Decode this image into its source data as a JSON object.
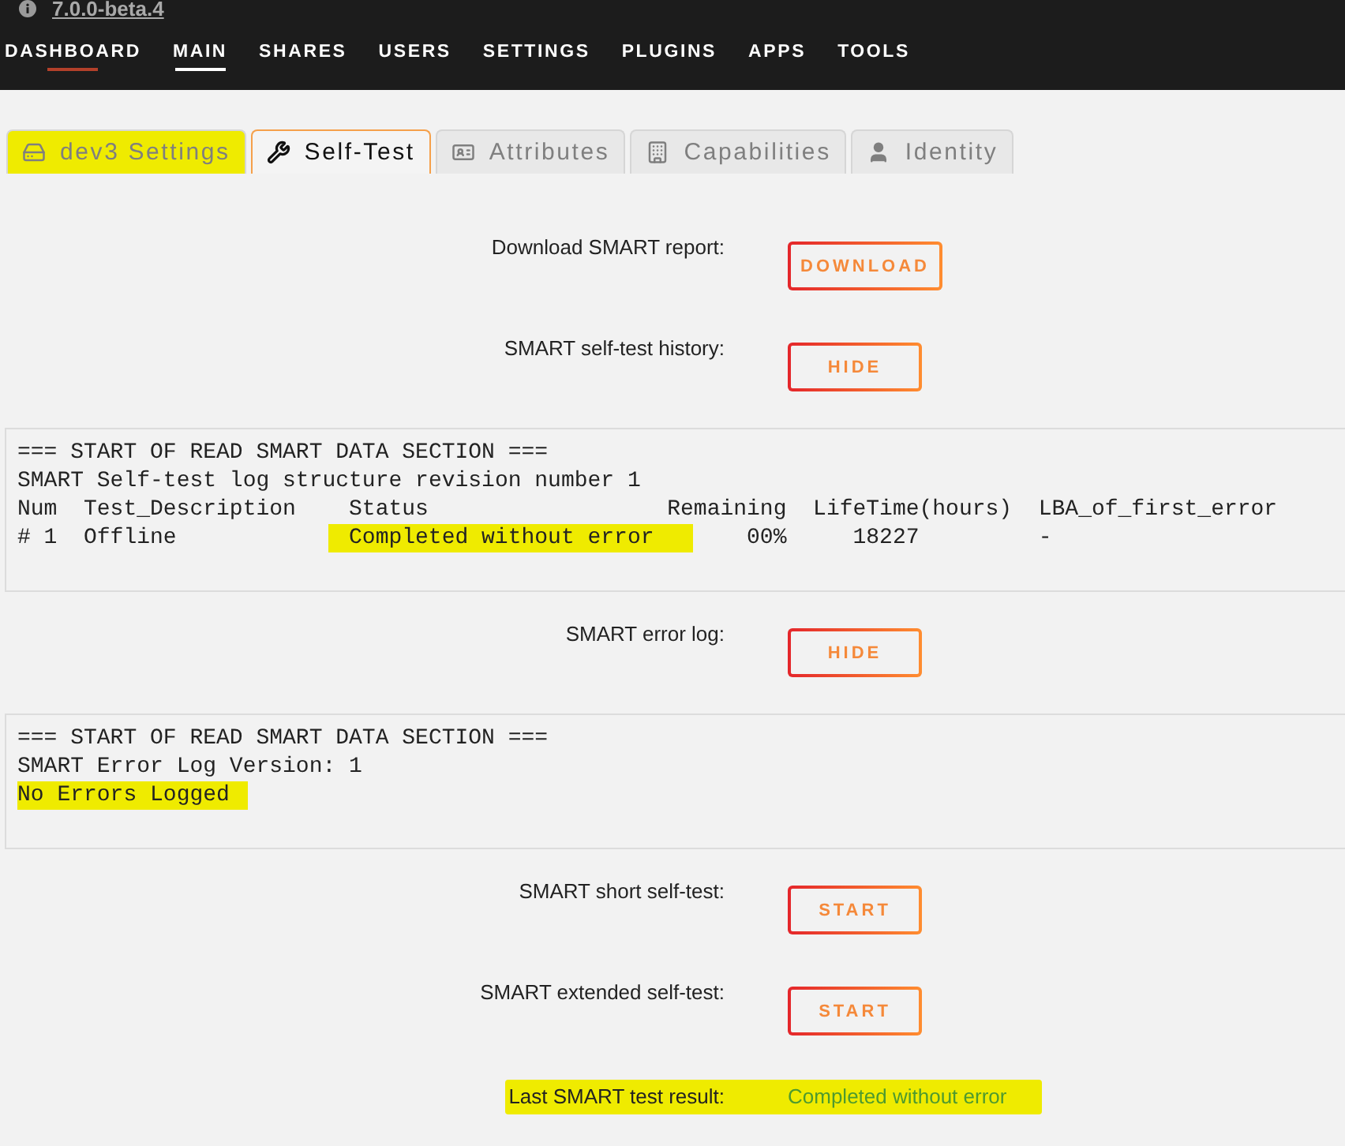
{
  "top_bar": {
    "version": "7.0.0-beta.4"
  },
  "nav": [
    {
      "label": "DASHBOARD",
      "selected": false,
      "hovered": true
    },
    {
      "label": "MAIN",
      "selected": true,
      "hovered": false
    },
    {
      "label": "SHARES",
      "selected": false,
      "hovered": false
    },
    {
      "label": "USERS",
      "selected": false,
      "hovered": false
    },
    {
      "label": "SETTINGS",
      "selected": false,
      "hovered": false
    },
    {
      "label": "PLUGINS",
      "selected": false,
      "hovered": false
    },
    {
      "label": "APPS",
      "selected": false,
      "hovered": false
    },
    {
      "label": "TOOLS",
      "selected": false,
      "hovered": false
    }
  ],
  "tabs": [
    {
      "label": "dev3 Settings",
      "selected": false,
      "highlighted": true
    },
    {
      "label": "Self-Test",
      "selected": true,
      "highlighted": false
    },
    {
      "label": "Attributes",
      "selected": false,
      "highlighted": false
    },
    {
      "label": "Capabilities",
      "selected": false,
      "highlighted": false
    },
    {
      "label": "Identity",
      "selected": false,
      "highlighted": false
    }
  ],
  "sections": [
    {
      "kind": "action",
      "label": "Download SMART report:",
      "button": "DOWNLOAD"
    },
    {
      "kind": "action",
      "label": "SMART self-test history:",
      "button": "HIDE"
    },
    {
      "kind": "log",
      "lines": [
        {
          "text": "=== START OF READ SMART DATA SECTION ===",
          "highlighted": false
        },
        {
          "text": "SMART Self-test log structure revision number 1",
          "highlighted": false
        }
      ],
      "columns": [
        "Num",
        "Test_Description",
        "Status",
        "Remaining",
        "LifeTime(hours)",
        "LBA_of_first_error"
      ],
      "rows": [
        {
          "cells": [
            {
              "text": "# 1",
              "highlighted": false
            },
            {
              "text": "Offline",
              "highlighted": false
            },
            {
              "text": "Completed without error",
              "highlighted": true
            },
            {
              "text": "00%",
              "highlighted": false
            },
            {
              "text": "18227",
              "highlighted": false
            },
            {
              "text": "-",
              "highlighted": false
            }
          ]
        }
      ]
    },
    {
      "kind": "action",
      "label": "SMART error log:",
      "button": "HIDE"
    },
    {
      "kind": "log",
      "lines": [
        {
          "text": "=== START OF READ SMART DATA SECTION ===",
          "highlighted": false
        },
        {
          "text": "SMART Error Log Version: 1",
          "highlighted": false
        },
        {
          "text": "No Errors Logged",
          "highlighted": true
        }
      ]
    },
    {
      "kind": "action",
      "label": "SMART short self-test:",
      "button": "START"
    },
    {
      "kind": "action",
      "label": "SMART extended self-test:",
      "button": "START"
    },
    {
      "kind": "result",
      "label": "Last SMART test result:",
      "value": "Completed without error",
      "passed": true,
      "highlighted": true
    }
  ]
}
